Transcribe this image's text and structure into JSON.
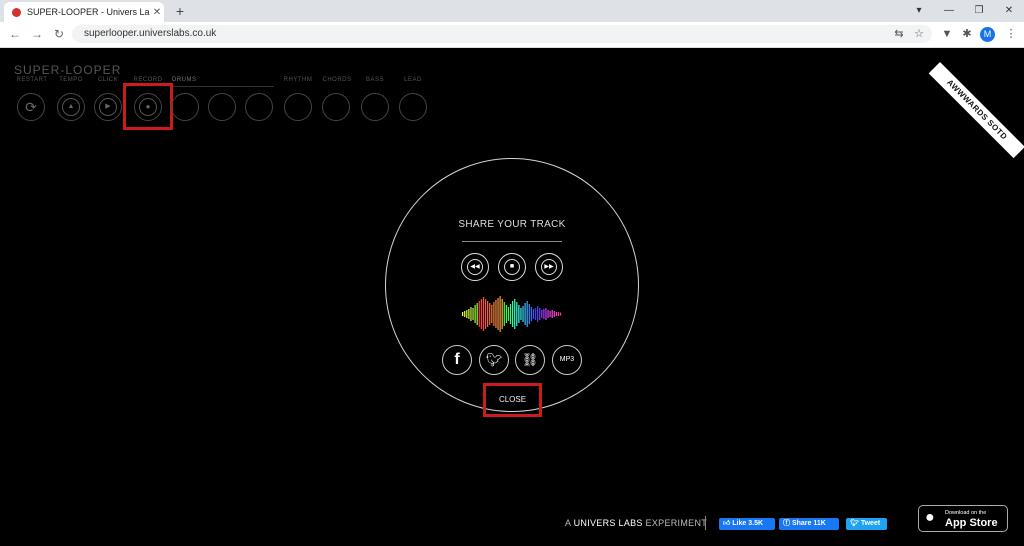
{
  "browser": {
    "tab_title": "SUPER-LOOPER - Univers Labs",
    "new_tab": "+",
    "url": "superlooper.universlabs.co.uk",
    "profile_initial": "M"
  },
  "app": {
    "logo": "SUPER-LOOPER",
    "controls": [
      {
        "label": "RESTART"
      },
      {
        "label": "TEMPO"
      },
      {
        "label": "CLICK"
      },
      {
        "label": "RECORD"
      }
    ],
    "groups": [
      "DRUMS",
      "RHYTHM",
      "CHORDS",
      "BASS",
      "LEAD"
    ],
    "award": "AWWWARDS SOTD"
  },
  "share": {
    "title": "SHARE YOUR TRACK",
    "mp3_label": "MP3",
    "close_label": "CLOSE"
  },
  "footer": {
    "brand_prefix": "A ",
    "brand_name": "UNIVERS LABS",
    "brand_suffix": " EXPERIMENT",
    "like_label": "Like 3.5K",
    "share_label": "Share 11K",
    "tweet_label": "Tweet",
    "appstore_small": "Download on the",
    "appstore_big": "App Store"
  },
  "colors": {
    "highlight": "#cc1b1b",
    "facebook": "#1877f2",
    "twitter": "#1da1f2"
  }
}
